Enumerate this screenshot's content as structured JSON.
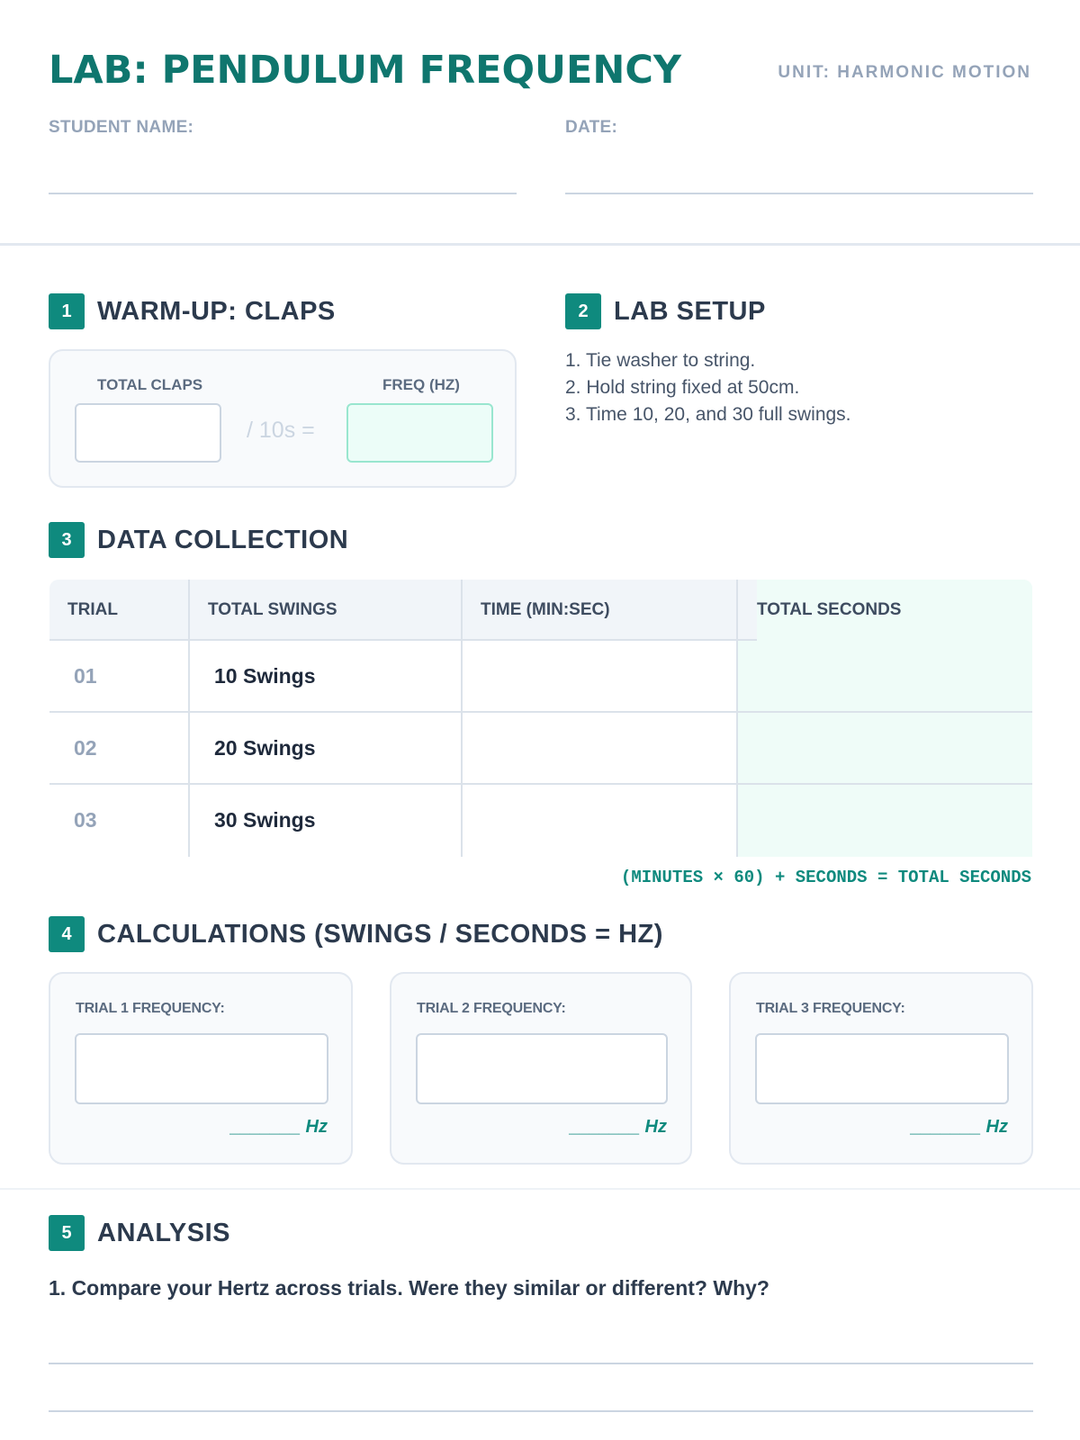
{
  "header": {
    "title": "LAB: PENDULUM FREQUENCY",
    "unit": "UNIT: HARMONIC MOTION",
    "student_name_label": "STUDENT NAME:",
    "date_label": "DATE:"
  },
  "sections": {
    "warmup": {
      "number": "1",
      "title": "WARM-UP: CLAPS",
      "total_claps_label": "TOTAL CLAPS",
      "freq_label": "FREQ (HZ)",
      "divide_text": "/ 10s ="
    },
    "setup": {
      "number": "2",
      "title": "LAB SETUP",
      "steps": [
        "1. Tie washer to string.",
        "2. Hold string fixed at 50cm.",
        "3. Time 10, 20, and 30 full swings."
      ]
    },
    "data": {
      "number": "3",
      "title": "DATA COLLECTION",
      "headers": [
        "TRIAL",
        "TOTAL SWINGS",
        "TIME (MIN:SEC)",
        "TOTAL SECONDS"
      ],
      "rows": [
        {
          "trial": "01",
          "swings": "10 Swings"
        },
        {
          "trial": "02",
          "swings": "20 Swings"
        },
        {
          "trial": "03",
          "swings": "30 Swings"
        }
      ],
      "formula": "(MINUTES × 60) + SECONDS = TOTAL SECONDS"
    },
    "calculations": {
      "number": "4",
      "title": "CALCULATIONS (SWINGS / SECONDS = HZ)",
      "cards": [
        {
          "label": "TRIAL 1 FREQUENCY:",
          "unit": "_______ Hz"
        },
        {
          "label": "TRIAL 2 FREQUENCY:",
          "unit": "_______ Hz"
        },
        {
          "label": "TRIAL 3 FREQUENCY:",
          "unit": "_______ Hz"
        }
      ]
    },
    "analysis": {
      "number": "5",
      "title": "ANALYSIS",
      "question": "1. Compare your Hertz across trials. Were they similar or different? Why?"
    }
  },
  "colors": {
    "accent": "#0f8a7e",
    "title": "#0f766e",
    "muted": "#94a3b8",
    "highlight_fill": "#effcf8"
  }
}
